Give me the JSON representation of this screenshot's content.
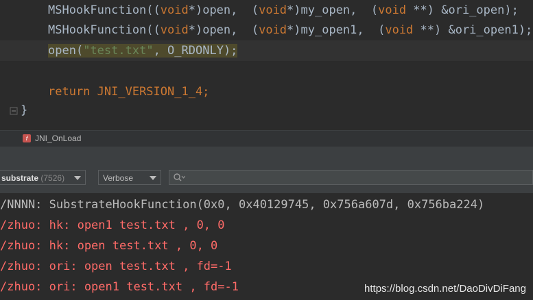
{
  "editor": {
    "lines": [
      {
        "fn": "MSHookFunction",
        "a1": "((",
        "k1": "void",
        "a2": "*)open,  (",
        "k2": "void",
        "a3": "*)my_open,  (",
        "k3": "void",
        "a4": " **) &ori_open);"
      },
      {
        "fn": "MSHookFunction",
        "a1": "((",
        "k1": "void",
        "a2": "*)open,  (",
        "k2": "void",
        "a3": "*)my_open1,  (",
        "k3": "void",
        "a4": " **) &ori_open1);"
      }
    ],
    "call_line": {
      "fn": "open",
      "p1": "(",
      "str": "\"test.txt\"",
      "sep": ", ",
      "const": "O_RDONLY",
      "end": ");"
    },
    "return_line": {
      "kw": "return",
      "val": " JNI_VERSION_1_4;"
    },
    "closing_brace": "}"
  },
  "breadcrumb": {
    "badge": "f",
    "label": "JNI_OnLoad"
  },
  "toolbar": {
    "process_name": "substrate",
    "process_pid": "(7526)",
    "log_level": "Verbose",
    "search_icon": "search-icon"
  },
  "log_lines": [
    {
      "text": "/NNNN: SubstrateHookFunction(0x0, 0x40129745, 0x756a607d, 0x756ba224)",
      "color": "#bbbbbb"
    },
    {
      "text": "/zhuo: hk: open1 test.txt , 0, 0",
      "color": "#ff6b68"
    },
    {
      "text": "/zhuo: hk: open test.txt , 0, 0",
      "color": "#ff6b68"
    },
    {
      "text": "/zhuo: ori: open test.txt , fd=-1",
      "color": "#ff6b68"
    },
    {
      "text": "/zhuo: ori: open1 test.txt , fd=-1",
      "color": "#ff6b68"
    }
  ],
  "watermark": "https://blog.csdn.net/DaoDivDiFang"
}
